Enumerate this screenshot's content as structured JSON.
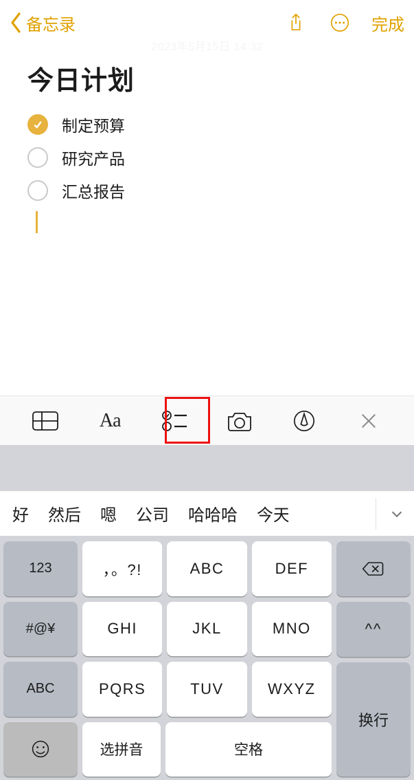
{
  "nav": {
    "back_label": "备忘录",
    "done_label": "完成"
  },
  "date_line": "2023年5月15日 14:32",
  "note": {
    "title": "今日计划",
    "items": [
      {
        "checked": true,
        "text": "制定预算"
      },
      {
        "checked": false,
        "text": "研究产品"
      },
      {
        "checked": false,
        "text": "汇总报告"
      }
    ]
  },
  "fmt": {
    "aa": "Aa"
  },
  "candidates": [
    "好",
    "然后",
    "嗯",
    "公司",
    "哈哈哈",
    "今天"
  ],
  "keys": {
    "left": [
      "123",
      "#@¥",
      "ABC"
    ],
    "punct": "，。?!",
    "grid": [
      [
        "ABC",
        "DEF"
      ],
      [
        "GHI",
        "JKL",
        "MNO"
      ],
      [
        "PQRS",
        "TUV",
        "WXYZ"
      ]
    ],
    "face": "^^",
    "enter": "换行",
    "select_pinyin": "选拼音",
    "space": "空格",
    "emoji": "☺"
  }
}
